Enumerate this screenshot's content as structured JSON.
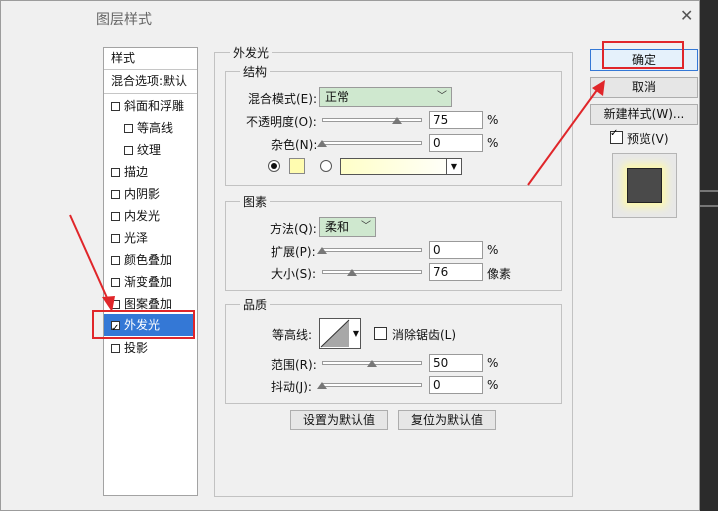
{
  "window": {
    "title": "图层样式"
  },
  "sidebar": {
    "header": "样式",
    "blend_options": "混合选项:默认",
    "items": [
      {
        "label": "斜面和浮雕",
        "checked": false
      },
      {
        "label": "等高线",
        "checked": false
      },
      {
        "label": "纹理",
        "checked": false
      },
      {
        "label": "描边",
        "checked": false
      },
      {
        "label": "内阴影",
        "checked": false
      },
      {
        "label": "内发光",
        "checked": false
      },
      {
        "label": "光泽",
        "checked": false
      },
      {
        "label": "颜色叠加",
        "checked": false
      },
      {
        "label": "渐变叠加",
        "checked": false
      },
      {
        "label": "图案叠加",
        "checked": false
      },
      {
        "label": "外发光",
        "checked": true
      },
      {
        "label": "投影",
        "checked": false
      }
    ]
  },
  "panel": {
    "title": "外发光",
    "structure": {
      "legend": "结构",
      "blend_mode_label": "混合模式(E):",
      "blend_mode_value": "正常",
      "opacity_label": "不透明度(O):",
      "opacity_value": "75",
      "opacity_pct": 75,
      "noise_label": "杂色(N):",
      "noise_value": "0",
      "noise_pct": 0,
      "unit_pct": "%",
      "color_swatch": "#fffcb0"
    },
    "elements": {
      "legend": "图素",
      "method_label": "方法(Q):",
      "method_value": "柔和",
      "spread_label": "扩展(P):",
      "spread_value": "0",
      "spread_pct": 0,
      "size_label": "大小(S):",
      "size_value": "76",
      "size_pct": 30,
      "unit_pct": "%",
      "unit_px": "像素"
    },
    "quality": {
      "legend": "品质",
      "contour_label": "等高线:",
      "antialias_label": "消除锯齿(L)",
      "range_label": "范围(R):",
      "range_value": "50",
      "range_pct": 50,
      "jitter_label": "抖动(J):",
      "jitter_value": "0",
      "jitter_pct": 0,
      "unit_pct": "%"
    },
    "make_default": "设置为默认值",
    "reset_default": "复位为默认值"
  },
  "actions": {
    "ok": "确定",
    "cancel": "取消",
    "new_style": "新建样式(W)...",
    "preview": "预览(V)",
    "preview_checked": true
  },
  "colors": {
    "annotation": "#e0262a",
    "selection": "#3478d6"
  }
}
